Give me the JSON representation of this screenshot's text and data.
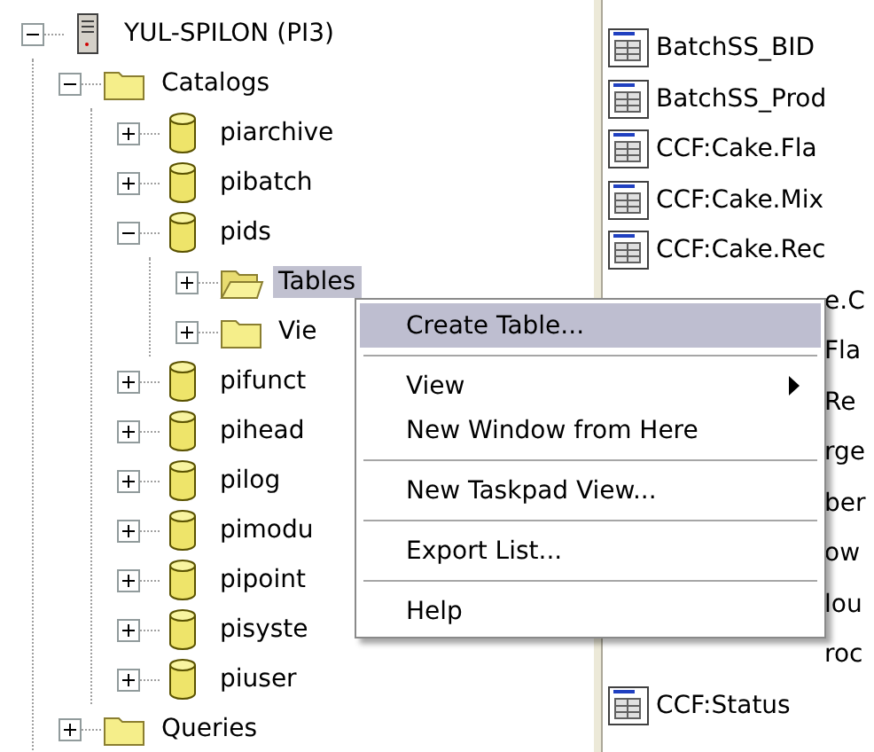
{
  "tree": [
    {
      "label": "YUL-SPILON (PI3)",
      "kind": "server",
      "expanded": true,
      "selected": false,
      "children": [
        {
          "label": "Catalogs",
          "kind": "folder",
          "expanded": true,
          "selected": false,
          "children": [
            {
              "label": "piarchive",
              "kind": "database",
              "expanded": false,
              "selected": false
            },
            {
              "label": "pibatch",
              "kind": "database",
              "expanded": false,
              "selected": false
            },
            {
              "label": "pids",
              "kind": "database",
              "expanded": true,
              "selected": false,
              "children": [
                {
                  "label": "Tables",
                  "kind": "open-folder",
                  "expanded": false,
                  "selected": true
                },
                {
                  "label": "Vie",
                  "kind": "folder",
                  "expanded": false,
                  "selected": false
                }
              ]
            },
            {
              "label": "pifunct",
              "kind": "database",
              "expanded": false,
              "selected": false
            },
            {
              "label": "pihead",
              "kind": "database",
              "expanded": false,
              "selected": false
            },
            {
              "label": "pilog",
              "kind": "database",
              "expanded": false,
              "selected": false
            },
            {
              "label": "pimodu",
              "kind": "database",
              "expanded": false,
              "selected": false
            },
            {
              "label": "pipoint",
              "kind": "database",
              "expanded": false,
              "selected": false
            },
            {
              "label": "pisyste",
              "kind": "database",
              "expanded": false,
              "selected": false
            },
            {
              "label": "piuser",
              "kind": "database",
              "expanded": false,
              "selected": false
            }
          ]
        },
        {
          "label": "Queries",
          "kind": "folder",
          "expanded": false,
          "selected": false
        }
      ]
    }
  ],
  "list": [
    {
      "kind": "table",
      "text": "BatchSS_BID"
    },
    {
      "kind": "table",
      "text": "BatchSS_Prod"
    },
    {
      "kind": "table",
      "text": "CCF:Cake.Fla"
    },
    {
      "kind": "table",
      "text": "CCF:Cake.Mix"
    },
    {
      "kind": "table",
      "text": "CCF:Cake.Rec"
    },
    {
      "kind": "clipped",
      "text": "e.C"
    },
    {
      "kind": "clipped",
      "text": "Fla"
    },
    {
      "kind": "clipped",
      "text": "Re"
    },
    {
      "kind": "clipped",
      "text": "rge"
    },
    {
      "kind": "clipped",
      "text": "ber"
    },
    {
      "kind": "clipped",
      "text": "ow"
    },
    {
      "kind": "clipped",
      "text": "lou"
    },
    {
      "kind": "clipped",
      "text": "roc"
    },
    {
      "kind": "table",
      "text": "CCF:Status"
    }
  ],
  "context_menu": [
    {
      "kind": "item",
      "label": "Create Table...",
      "selected": true
    },
    {
      "kind": "separator"
    },
    {
      "kind": "item",
      "label": "View",
      "selected": false,
      "has_submenu": true
    },
    {
      "kind": "item",
      "label": "New Window from Here",
      "selected": false
    },
    {
      "kind": "separator"
    },
    {
      "kind": "item",
      "label": "New Taskpad View...",
      "selected": false
    },
    {
      "kind": "separator"
    },
    {
      "kind": "item",
      "label": "Export List...",
      "selected": false
    },
    {
      "kind": "separator"
    },
    {
      "kind": "item",
      "label": "Help",
      "selected": false
    }
  ]
}
